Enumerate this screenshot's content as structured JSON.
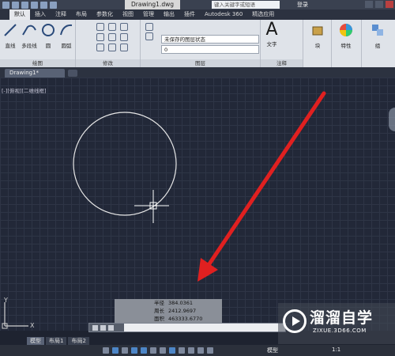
{
  "titlebar": {
    "document": "Drawing1.dwg",
    "search_placeholder": "键入关键字或短语",
    "login": "登录"
  },
  "ribbon_tabs": [
    "默认",
    "插入",
    "注释",
    "布局",
    "参数化",
    "视图",
    "管理",
    "输出",
    "插件",
    "Autodesk 360",
    "精选应用"
  ],
  "ribbon": {
    "draw": {
      "label": "绘图",
      "buttons": [
        "直线",
        "多段线",
        "圆",
        "圆弧"
      ]
    },
    "modify": {
      "label": "修改"
    },
    "layers": {
      "label": "图层",
      "layer_state": "未保存的图层状态",
      "current_layer": "0"
    },
    "annotation": {
      "label": "注释",
      "text": "文字"
    },
    "block": {
      "label": "块",
      "icon_text": "A"
    },
    "properties": {
      "label": "特性"
    },
    "groups": {
      "label": "组"
    }
  },
  "document_tab": "Drawing1*",
  "viewport_label": "[-][俯视][二维线框]",
  "measure": {
    "radius_label": "半径",
    "radius_value": "384.0361",
    "circumference_label": "周长",
    "circumference_value": "2412.9697",
    "area_label": "面积",
    "area_value": "463333.6770"
  },
  "layout_tabs": [
    "模型",
    "布局1",
    "布局2"
  ],
  "status": {
    "model": "模型",
    "scale": "1:1"
  },
  "watermark": {
    "main": "溜溜自学",
    "sub": "ZIXUE.3D66.COM"
  },
  "colors": {
    "canvas": "#222838",
    "arrow": "#e02020",
    "circle": "#e8e8e8"
  }
}
